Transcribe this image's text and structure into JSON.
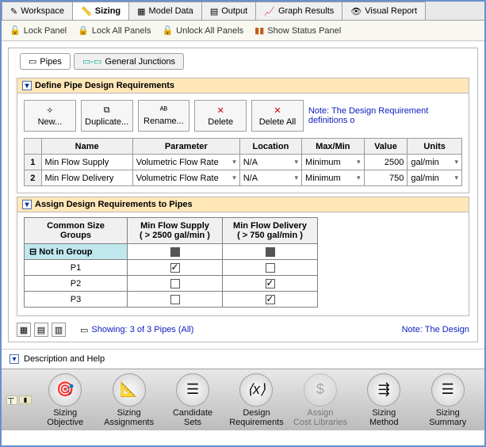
{
  "top_tabs": [
    {
      "label": "Workspace"
    },
    {
      "label": "Sizing",
      "active": true
    },
    {
      "label": "Model Data"
    },
    {
      "label": "Output"
    },
    {
      "label": "Graph Results"
    },
    {
      "label": "Visual Report"
    }
  ],
  "toolbar": [
    {
      "label": "Lock Panel"
    },
    {
      "label": "Lock All Panels"
    },
    {
      "label": "Unlock All Panels"
    },
    {
      "label": "Show Status Panel"
    }
  ],
  "subtabs": [
    {
      "label": "Pipes",
      "active": true
    },
    {
      "label": "General Junctions"
    }
  ],
  "section_define": {
    "title": "Define Pipe Design Requirements",
    "buttons": [
      "New...",
      "Duplicate...",
      "Rename...",
      "Delete",
      "Delete All"
    ],
    "note": "Note: The Design Requirement definitions o",
    "columns": [
      "",
      "Name",
      "Parameter",
      "Location",
      "Max/Min",
      "Value",
      "Units"
    ],
    "rows": [
      {
        "n": "1",
        "name": "Min Flow Supply",
        "param": "Volumetric Flow Rate",
        "loc": "N/A",
        "mm": "Minimum",
        "val": "2500",
        "units": "gal/min"
      },
      {
        "n": "2",
        "name": "Min Flow Delivery",
        "param": "Volumetric Flow Rate",
        "loc": "N/A",
        "mm": "Minimum",
        "val": "750",
        "units": "gal/min"
      }
    ]
  },
  "section_assign": {
    "title": "Assign Design Requirements to Pipes",
    "col_group": "Common Size\nGroups",
    "cols": [
      {
        "name": "Min Flow Supply",
        "sub": "( > 2500 gal/min )"
      },
      {
        "name": "Min Flow Delivery",
        "sub": "( > 750 gal/min )"
      }
    ],
    "group_label": "Not in Group",
    "rows": [
      {
        "name": "P1",
        "c": [
          true,
          false
        ]
      },
      {
        "name": "P2",
        "c": [
          false,
          true
        ]
      },
      {
        "name": "P3",
        "c": [
          false,
          true
        ]
      }
    ]
  },
  "status": {
    "showing": "Showing: 3 of 3 Pipes (All)",
    "note": "Note: The Design"
  },
  "help": {
    "label": "Description and Help"
  },
  "bottom": [
    {
      "label": "Sizing\nObjective",
      "icon": "target"
    },
    {
      "label": "Sizing\nAssignments",
      "icon": "ruler"
    },
    {
      "label": "Candidate\nSets",
      "icon": "list"
    },
    {
      "label": "Design\nRequirements",
      "icon": "x"
    },
    {
      "label": "Assign\nCost Libraries",
      "icon": "money",
      "disabled": true
    },
    {
      "label": "Sizing\nMethod",
      "icon": "flow"
    },
    {
      "label": "Sizing\nSummary",
      "icon": "doc"
    }
  ]
}
